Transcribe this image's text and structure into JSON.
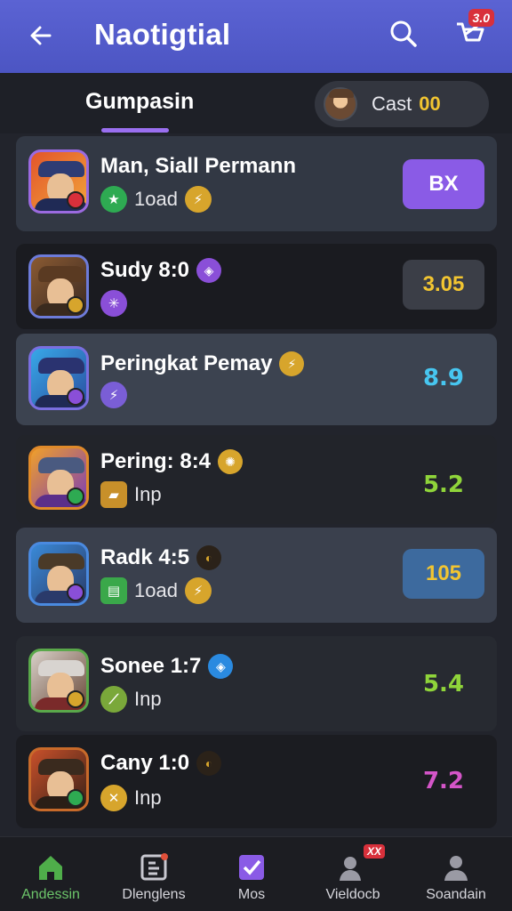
{
  "header": {
    "title": "Naotigtial",
    "cart_badge": "3.0"
  },
  "tabs": {
    "active_label": "Gumpasin"
  },
  "cast": {
    "label": "Cast",
    "value": "00"
  },
  "items": [
    {
      "name": "Man, Siall Permann",
      "meta_text": "1oad",
      "action": "BX"
    },
    {
      "name": "Sudy 8:0",
      "meta_text": "",
      "action": "3.05"
    },
    {
      "name": "Peringkat Pemay",
      "meta_text": "",
      "action": "8.9"
    },
    {
      "name": "Pering: 8:4",
      "meta_text": "Inp",
      "action": "5.2"
    },
    {
      "name": "Radk 4:5",
      "meta_text": "1oad",
      "action": "105"
    },
    {
      "name": "Sonee 1:7",
      "meta_text": "Inp",
      "action": "5.4"
    },
    {
      "name": "Cany 1:0",
      "meta_text": "Inp",
      "action": "7.2"
    }
  ],
  "colors": {
    "header": "#5b63d3",
    "accent_purple": "#9a6ff0",
    "value_yellow": "#f2c531",
    "value_cyan": "#47c6f0",
    "value_green": "#8fd43a",
    "value_magenta": "#d455c8",
    "nav_active": "#6cc56a"
  },
  "nav": {
    "items": [
      {
        "label": "Andessin",
        "icon": "home-icon"
      },
      {
        "label": "Dlenglens",
        "icon": "document-icon"
      },
      {
        "label": "Mos",
        "icon": "checkbox-icon"
      },
      {
        "label": "Vieldocb",
        "icon": "friends-icon",
        "badge": "XX"
      },
      {
        "label": "Soandain",
        "icon": "profile-icon"
      }
    ]
  }
}
